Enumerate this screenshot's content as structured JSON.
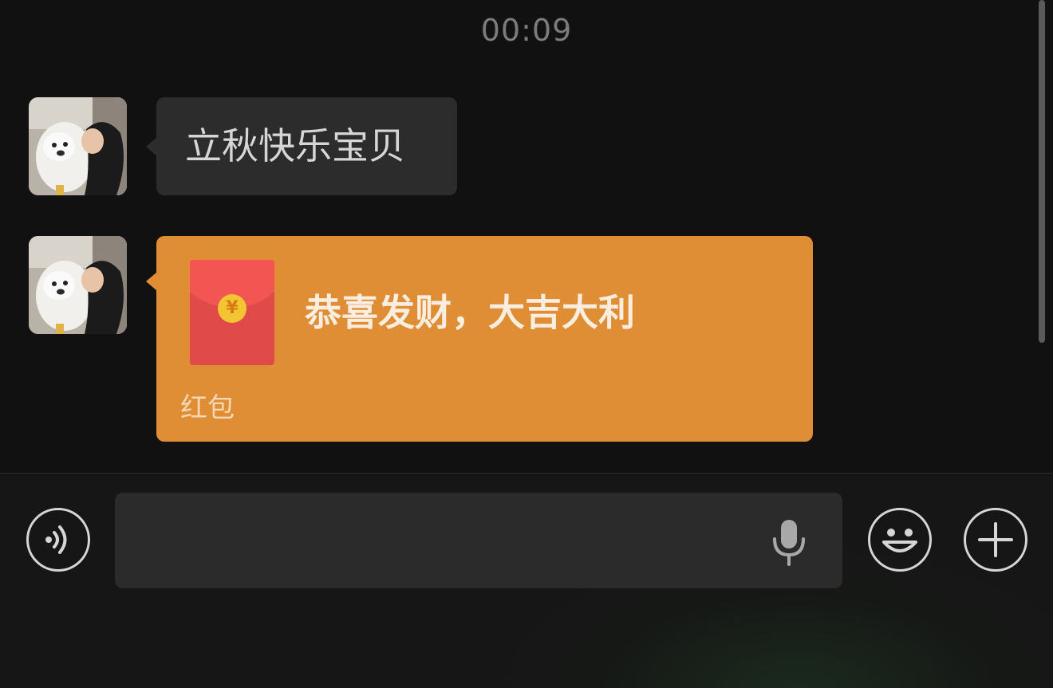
{
  "chat": {
    "timestamp": "00:09",
    "messages": [
      {
        "type": "text",
        "text": "立秋快乐宝贝"
      },
      {
        "type": "red_packet",
        "title": "恭喜发财，大吉大利",
        "label": "红包",
        "coin_symbol": "¥"
      }
    ]
  },
  "input_bar": {
    "voice_icon": "voice-mode-icon",
    "mic_icon": "microphone-icon",
    "emoji_icon": "emoji-icon",
    "plus_icon": "plus-icon"
  },
  "colors": {
    "background": "#111111",
    "text_bubble": "#2c2c2c",
    "red_packet_bubble": "#e08e36",
    "envelope": "#e04a48"
  }
}
